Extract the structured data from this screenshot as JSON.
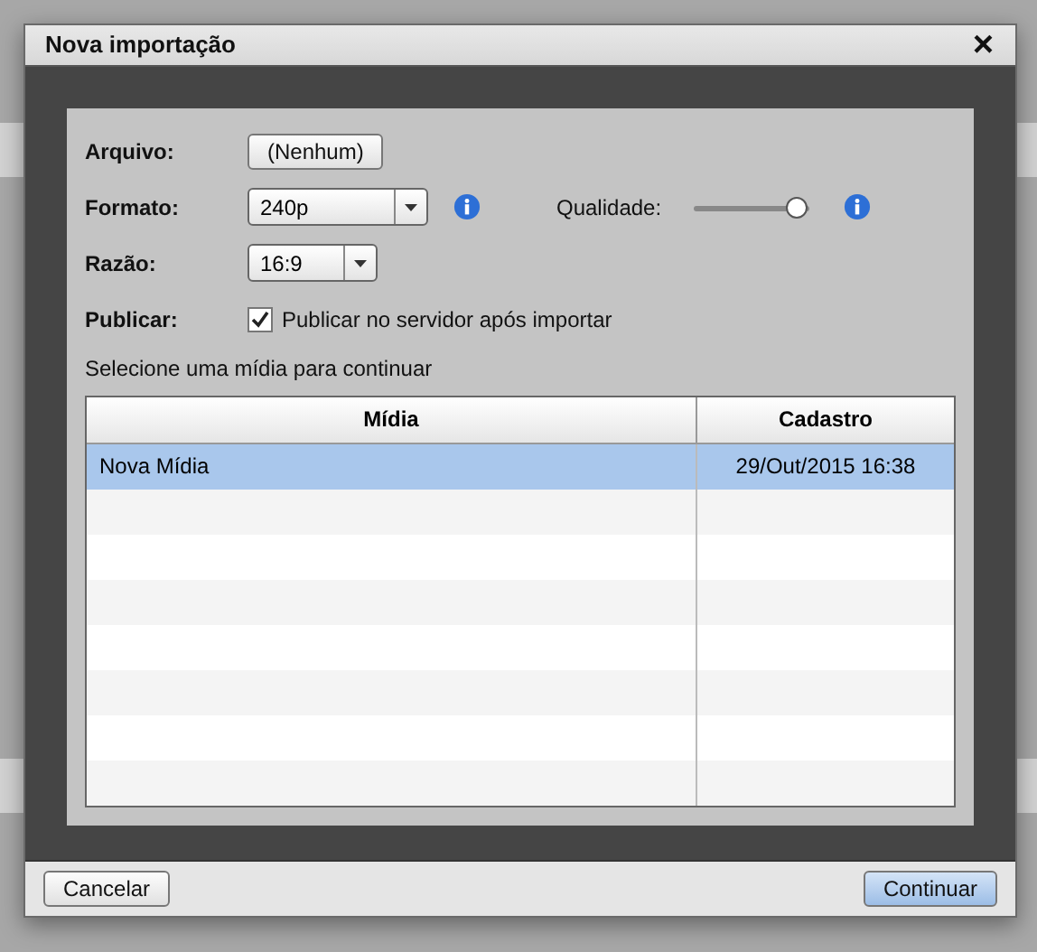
{
  "dialog": {
    "title": "Nova importação",
    "close": "×"
  },
  "form": {
    "arquivo": {
      "label": "Arquivo:",
      "button": "(Nenhum)"
    },
    "formato": {
      "label": "Formato:",
      "value": "240p"
    },
    "qualidade": {
      "label": "Qualidade:",
      "level": 0.9
    },
    "razao": {
      "label": "Razão:",
      "value": "16:9"
    },
    "publicar": {
      "label": "Publicar:",
      "option": "Publicar no servidor após importar",
      "checked": true
    },
    "hint": "Selecione uma mídia para continuar"
  },
  "table": {
    "columns": [
      "Mídia",
      "Cadastro"
    ],
    "rows": [
      {
        "cells": [
          "Nova Mídia",
          "29/Out/2015 16:38"
        ],
        "selected": true
      }
    ]
  },
  "footer": {
    "buttons": [
      {
        "label": "Cancelar",
        "kind": "default"
      },
      {
        "label": "Continuar",
        "kind": "primary"
      }
    ]
  }
}
